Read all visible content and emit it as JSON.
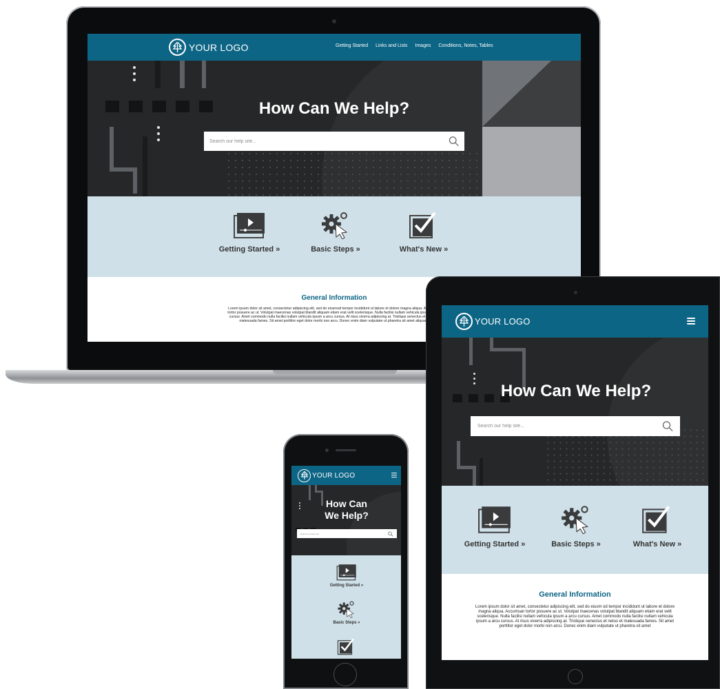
{
  "site": {
    "logo_text": "YOUR LOGO",
    "nav_items": [
      "Getting Started",
      "Links and Lists",
      "Images",
      "Conditions, Notes, Tables"
    ],
    "hero_title": "How Can We Help?",
    "search_placeholder": "Search our help site...",
    "categories": [
      {
        "label": "Getting Started »",
        "icon": "video-play-icon"
      },
      {
        "label": "Basic Steps »",
        "icon": "gear-cursor-icon"
      },
      {
        "label": "What's New »",
        "icon": "checkbox-icon"
      }
    ],
    "info_title": "General Information",
    "laptop_paragraph": "Lorem ipsum dolor sit amet, consectetur adipiscing elit, sed do eiusmod tempor incididunt ut labore et dolore magna aliqua. Accumsan tortor posuere ac ut. Volutpat maecenas volutpat blandit aliquam etiam erat velit scelerisque. Nulla facilisi nullam vehicula ipsum a arcu cursus. Amet commodo nulla facilisi nullam vehicula ipsum a arcu cursus. At risus viverra adipiscing at. Tristique senectus et netus et malesuada fames. Sit amet porttitor eget dolor morbi non arcu. Donec enim diam vulputate ut pharetra sit amet aliquam.",
    "tablet_paragraph": "Lorem ipsum dolor sit amet, consectetur adipiscing elit, sed do eiusm od tempor incididunt ut labore et dolore magna aliqua. Accumsan tortor posuere ac ut. Volutpat maecenas volutpat blandit aliquam etiam erat velit scelerisque. Nulla facilisi nullam vehicula ipsum a arcu cursus. Amet commodo nulla facilisi nullam vehicula ipsum a arcu cursus. At risus viverra adipiscing at. Tristique senectus et netus et malesuada fames. Sit amet porttitor eget dolor morbi non arcu. Donec enim diam vulputate ut pharetra sit amet",
    "phone_hero_line1": "How Can",
    "phone_hero_line2": "We Help?",
    "menu_icon": "hamburger-menu-icon"
  },
  "colors": {
    "brand": "#0d6585",
    "hero_bg": "#262728",
    "categories_bg": "#cfe0e8",
    "device_frame": "#141516"
  }
}
